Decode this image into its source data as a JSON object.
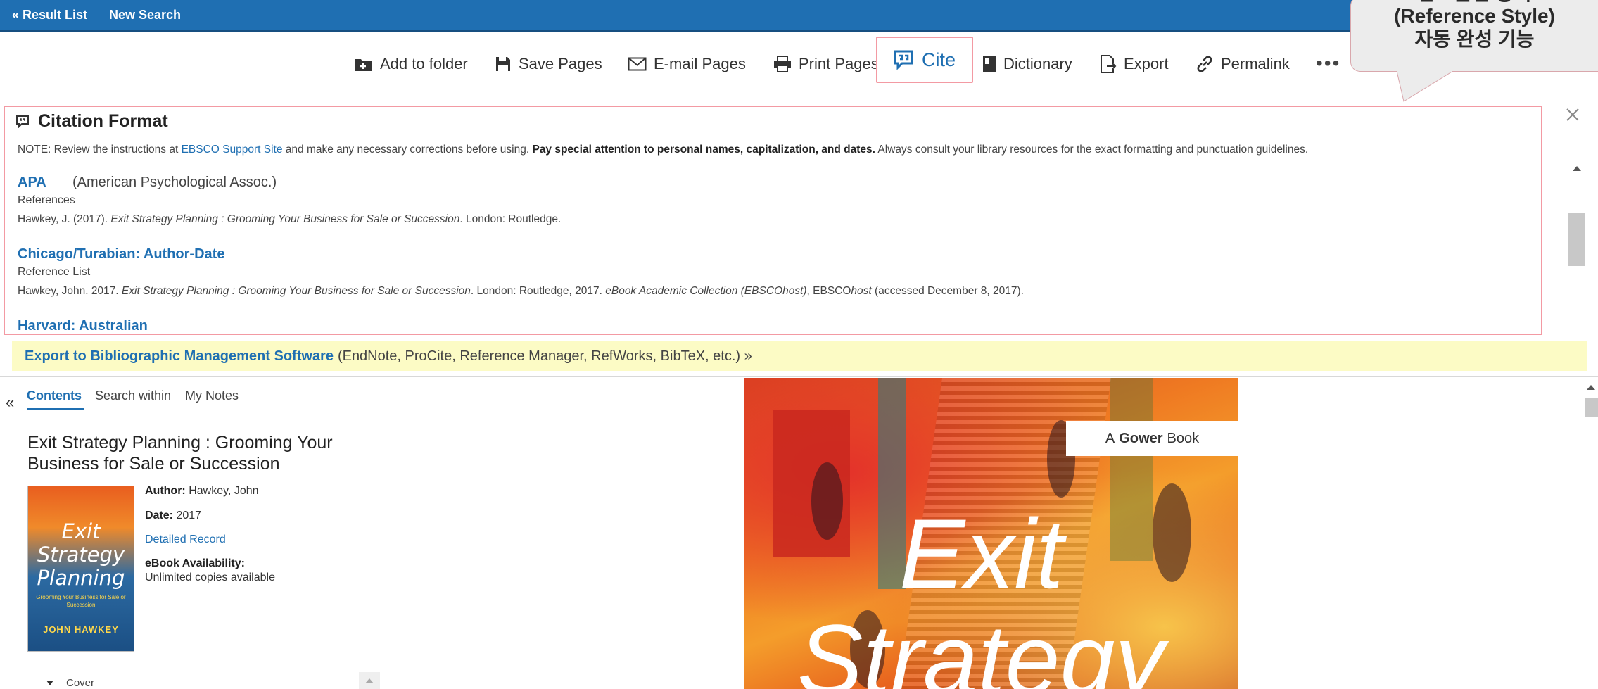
{
  "nav": {
    "result_list": "« Result List",
    "new_search": "New Search"
  },
  "toolbar": {
    "add_to_folder": "Add to folder",
    "save_pages": "Save Pages",
    "email_pages": "E-mail Pages",
    "print_pages": "Print Pages",
    "cite": "Cite",
    "dictionary": "Dictionary",
    "export": "Export",
    "permalink": "Permalink",
    "more": "•••"
  },
  "callout": {
    "line0": "참고문헌 양식",
    "line1": "(Reference Style)",
    "line2": "자동 완성 기능"
  },
  "citation": {
    "title": "Citation Format",
    "note_prefix": "NOTE: Review the instructions at ",
    "note_link": "EBSCO Support Site",
    "note_mid": " and make any necessary corrections before using. ",
    "note_bold": "Pay special attention to personal names, capitalization, and dates.",
    "note_suffix": " Always consult your library resources for the exact formatting and punctuation guidelines.",
    "styles": [
      {
        "name": "APA",
        "desc": "(American Psychological Assoc.)",
        "label": "References",
        "ref_before": "Hawkey, J. (2017). ",
        "ref_italic": "Exit Strategy Planning : Grooming Your Business for Sale or Succession",
        "ref_after": ". London: Routledge."
      },
      {
        "name": "Chicago/Turabian: Author-Date",
        "label": "Reference List",
        "ref_before": "Hawkey, John. 2017. ",
        "ref_italic": "Exit Strategy Planning : Grooming Your Business for Sale or Succession",
        "ref_mid": ". London: Routledge, 2017. ",
        "ref_italic2": "eBook Academic Collection (EBSCOhost)",
        "ref_mid2": ", EBSCO",
        "ref_italic3": "host",
        "ref_after": " (accessed December 8, 2017)."
      },
      {
        "name": "Harvard: Australian"
      }
    ]
  },
  "export_bar": {
    "link": "Export to Bibliographic Management Software",
    "desc": "(EndNote, ProCite, Reference Manager, RefWorks, BibTeX, etc.) »"
  },
  "pane": {
    "collapse": "«",
    "tabs": [
      "Contents",
      "Search within",
      "My Notes"
    ],
    "book_title": "Exit Strategy Planning : Grooming Your Business for Sale or Succession",
    "author_label": "Author:",
    "author": "Hawkey, John",
    "date_label": "Date:",
    "date": "2017",
    "detailed_record": "Detailed Record",
    "availability_label": "eBook Availability:",
    "availability": "Unlimited copies available",
    "toc_first": "Cover",
    "thumb_title": "Exit Strategy Planning",
    "thumb_subtitle": "Grooming Your Business for Sale or Succession",
    "thumb_author": "JOHN HAWKEY"
  },
  "cover": {
    "tag_prefix": "A",
    "tag_publisher": "Gower",
    "tag_suffix": "Book",
    "word1": "Exit",
    "word2": "Strategy"
  },
  "colors": {
    "nav_bar": "#1f6fb2",
    "highlight_border": "#f39aa3",
    "link": "#1f6fb2",
    "export_bar": "#fcfbc5"
  }
}
